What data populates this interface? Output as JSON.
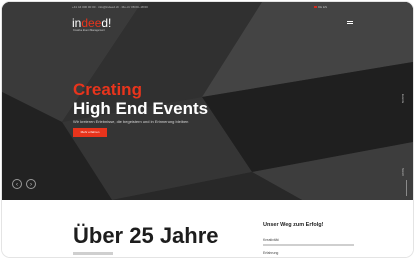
{
  "topbar": {
    "contact": "+41 44 000 00 00  ·  info@indeed.ch  ·  Mo–Fr 08:00–18:00",
    "language": "DE  EN"
  },
  "brand": {
    "logo_text_1": "in",
    "logo_accent": "dee",
    "logo_text_2": "d!",
    "tagline": "Creative Event Management"
  },
  "hero": {
    "headline_red": "Creating",
    "headline_white": "High End Events",
    "subline": "Wir kreieren Erlebnisse, die begeistern und in Erinnerung bleiben",
    "cta_label": "Mehr erfahren",
    "side_label": "Events",
    "scroll_label": "Scroll",
    "prev_label": "‹",
    "next_label": "›"
  },
  "about": {
    "title": "Über 25 Jahre",
    "path_title": "Unser Weg zum Erfolg!",
    "items": [
      {
        "label": "Kreativität",
        "progress": 1.0
      },
      {
        "label": "Erfahrung",
        "progress": 1.0
      }
    ]
  },
  "colors": {
    "accent": "#e8341c",
    "hero_bg": "#2a2a2a"
  },
  "icons": {
    "menu": "hamburger-icon",
    "prev": "chevron-left-icon",
    "next": "chevron-right-icon"
  }
}
